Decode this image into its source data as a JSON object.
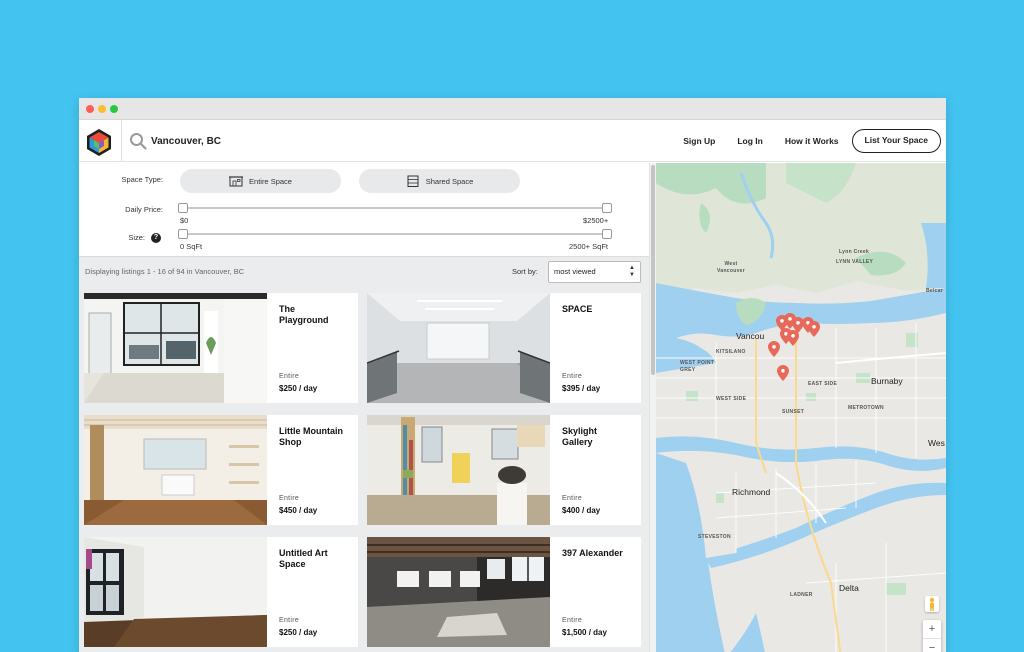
{
  "header": {
    "search_value": "Vancouver, BC",
    "nav": {
      "sign_up": "Sign Up",
      "log_in": "Log In",
      "how_it_works": "How it Works",
      "list_space": "List Your Space"
    }
  },
  "filters": {
    "space_type_label": "Space Type:",
    "entire_space": "Entire Space",
    "shared_space": "Shared Space",
    "daily_price_label": "Daily Price:",
    "price_min": "$0",
    "price_max": "$2500+",
    "size_label": "Size:",
    "size_help": "?",
    "size_min": "0 SqFt",
    "size_max": "2500+ SqFt"
  },
  "results": {
    "count_text": "Displaying listings 1 - 16 of 94 in Vancouver, BC",
    "sort_label": "Sort by:",
    "sort_value": "most viewed"
  },
  "listings": [
    {
      "title": "The Playground",
      "kind": "Entire",
      "price": "$250 / day"
    },
    {
      "title": "SPACE",
      "kind": "Entire",
      "price": "$395 / day"
    },
    {
      "title": "Little Mountain Shop",
      "kind": "Entire",
      "price": "$450 / day"
    },
    {
      "title": "Skylight Gallery",
      "kind": "Entire",
      "price": "$400 / day"
    },
    {
      "title": "Untitled Art Space",
      "kind": "Entire",
      "price": "$250 / day"
    },
    {
      "title": "397 Alexander",
      "kind": "Entire",
      "price": "$1,500 / day"
    }
  ],
  "map": {
    "places": {
      "lynn_creek": "Lynn Creek",
      "west_vancouver": "West Vancouver",
      "lynn_valley": "LYNN VALLEY",
      "vancouver": "Vancou",
      "kitsilano": "KITSILANO",
      "west_point_grey": "WEST POINT GREY",
      "east_side": "EAST SIDE",
      "burnaby": "Burnaby",
      "west_side": "WEST SIDE",
      "sunset": "SUNSET",
      "metrotown": "METROTOWN",
      "richmond": "Richmond",
      "steveston": "STEVESTON",
      "delta": "Delta",
      "ladner": "LADNER",
      "belcarra": "Belcar",
      "west_edge": "Wes"
    },
    "zoom_in": "+",
    "zoom_out": "−"
  },
  "colors": {
    "background": "#43c4f0",
    "pin": "#e8685a",
    "water": "#9fd0f0"
  }
}
